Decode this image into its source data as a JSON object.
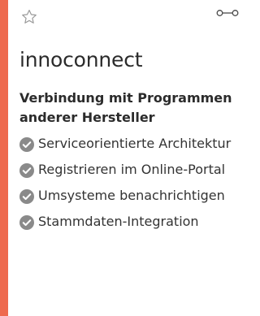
{
  "colors": {
    "accent": "#ee6a4e",
    "text": "#2b2b2b",
    "icon_gray": "#9a9a9a",
    "check_fill": "#8a8a8a"
  },
  "card": {
    "favorite_icon": "star-outline-icon",
    "link_icon": "link-nodes-icon",
    "title": "innoconnect",
    "subtitle": "Verbindung mit Program­men anderer Hersteller",
    "features": [
      {
        "icon": "check-circle-icon",
        "label": "Serviceorientierte Architektur"
      },
      {
        "icon": "check-circle-icon",
        "label": "Registrieren im Online-Portal"
      },
      {
        "icon": "check-circle-icon",
        "label": "Umsysteme benach­richtigen"
      },
      {
        "icon": "check-circle-icon",
        "label": "Stammdaten-Integration"
      }
    ]
  }
}
